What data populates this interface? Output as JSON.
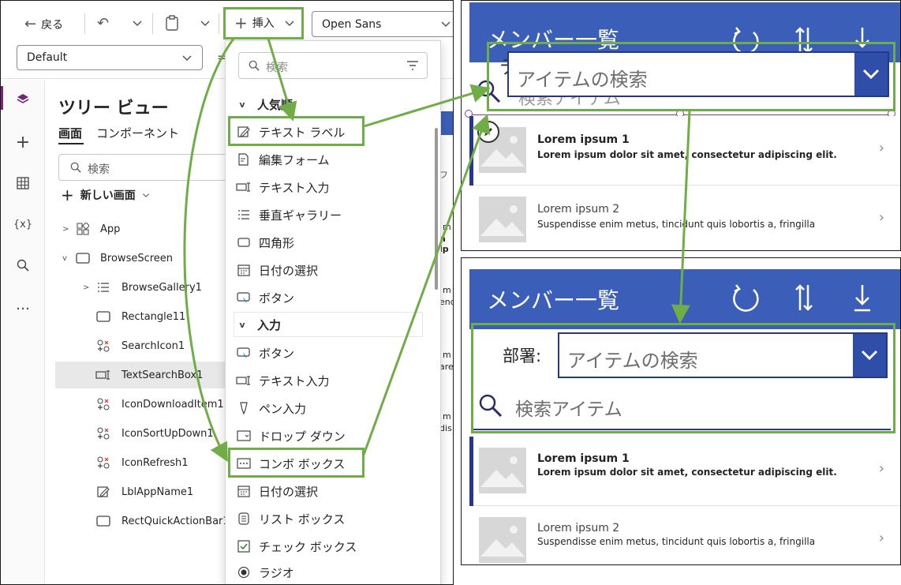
{
  "toolbar": {
    "back_label": "戻る",
    "insert_label": "挿入",
    "font_value": "Open Sans",
    "default_value": "Default",
    "menu_search_placeholder": "検索"
  },
  "rail": {
    "icons": [
      "layers-icon",
      "plus-icon",
      "table-icon",
      "variables-icon",
      "search-icon",
      "more-icon"
    ],
    "variables_text": "{x}",
    "more_text": "…"
  },
  "tree": {
    "title": "ツリー ビュー",
    "tab_screens": "画面",
    "tab_components": "コンポーネント",
    "search_placeholder": "検索",
    "new_screen": "新しい画面",
    "items": [
      {
        "label": "App",
        "icon": "app-icon"
      },
      {
        "label": "BrowseScreen",
        "icon": "screen-icon"
      },
      {
        "label": "BrowseGallery1",
        "icon": "gallery-icon"
      },
      {
        "label": "Rectangle11",
        "icon": "rectangle-icon"
      },
      {
        "label": "SearchIcon1",
        "icon": "icon-control-icon"
      },
      {
        "label": "TextSearchBox1",
        "icon": "text-input-icon"
      },
      {
        "label": "IconDownloadItem1",
        "icon": "icon-control-icon"
      },
      {
        "label": "IconSortUpDown1",
        "icon": "icon-control-icon"
      },
      {
        "label": "IconRefresh1",
        "icon": "icon-control-icon"
      },
      {
        "label": "LblAppName1",
        "icon": "label-edit-icon"
      },
      {
        "label": "RectQuickActionBar1",
        "icon": "rectangle-icon"
      }
    ]
  },
  "insert_menu": {
    "section_popular": "人気順",
    "popular_items": [
      {
        "label": "テキスト ラベル",
        "icon": "label-edit-icon"
      },
      {
        "label": "編集フォーム",
        "icon": "form-edit-icon"
      },
      {
        "label": "テキスト入力",
        "icon": "text-input-icon"
      },
      {
        "label": "垂直ギャラリー",
        "icon": "gallery-icon"
      },
      {
        "label": "四角形",
        "icon": "rectangle-icon"
      },
      {
        "label": "日付の選択",
        "icon": "calendar-icon"
      },
      {
        "label": "ボタン",
        "icon": "button-icon"
      }
    ],
    "section_input": "入力",
    "input_items": [
      {
        "label": "ボタン",
        "icon": "button-icon"
      },
      {
        "label": "テキスト入力",
        "icon": "text-input-icon"
      },
      {
        "label": "ペン入力",
        "icon": "pen-icon"
      },
      {
        "label": "ドロップ ダウン",
        "icon": "dropdown-icon"
      },
      {
        "label": "コンボ ボックス",
        "icon": "combobox-icon"
      },
      {
        "label": "日付の選択",
        "icon": "calendar-icon"
      },
      {
        "label": "リスト ボックス",
        "icon": "listbox-icon"
      },
      {
        "label": "チェック ボックス",
        "icon": "checkbox-icon"
      },
      {
        "label": "ラジオ",
        "icon": "radio-icon"
      }
    ]
  },
  "canvas_peek": {
    "frag_a": "フ",
    "frag_b": "m",
    "frag_c": "n ip",
    "frag_d": "m",
    "frag_e": "end",
    "frag_f": "m",
    "frag_g": "are",
    "frag_h": "m",
    "frag_i": "dis"
  },
  "preview_top": {
    "title": "メンバー一覧",
    "combo_placeholder": "アイテムの検索",
    "ghost_search": "検索アイテム",
    "ghost_label": "テ"
  },
  "preview_bottom": {
    "title": "メンバー一覧",
    "dept_label": "部署:",
    "combo_placeholder": "アイテムの検索",
    "search_placeholder": "検索アイテム"
  },
  "gallery": [
    {
      "title": "Lorem ipsum 1",
      "subtitle": "Lorem ipsum dolor sit amet, consectetur adipiscing elit.",
      "subtitle_bold": true
    },
    {
      "title": "Lorem ipsum 2",
      "subtitle": "Suspendisse enim metus, tincidunt quis lobortis a, fringilla",
      "subtitle_bold": false
    }
  ],
  "colors": {
    "header_blue": "#3b5fb8",
    "highlight_green": "#70ad47",
    "brand_purple": "#742774",
    "combo_navy": "#2f4ea9"
  }
}
